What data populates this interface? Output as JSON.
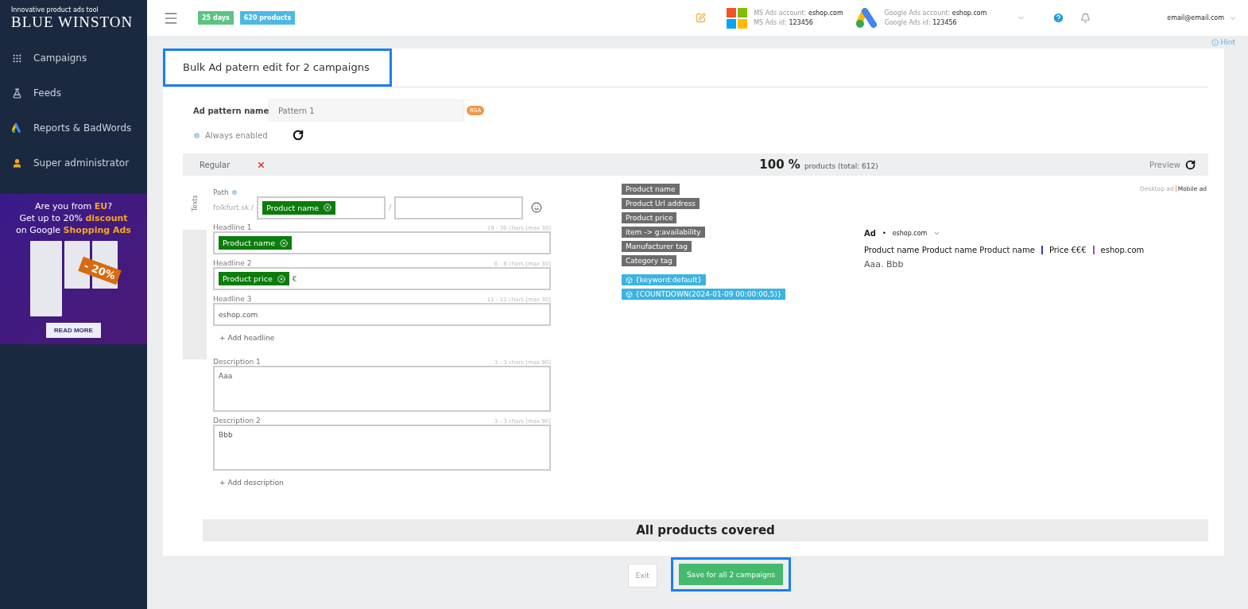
{
  "sidebar": {
    "tagline": "Innovative product ads tool",
    "logo": "BLUE WINSTON",
    "items": [
      {
        "label": "Campaigns",
        "kind": "grid",
        "selected": false
      },
      {
        "label": "Feeds",
        "kind": "flask",
        "selected": false
      },
      {
        "label": "Reports & BadWords",
        "kind": "ads",
        "selected": false
      },
      {
        "label": "Super administrator",
        "kind": "user",
        "selected": false
      }
    ],
    "banner": {
      "lines": [
        "Are you from **EU**?",
        "Get up to 20% **discount**",
        "on Google **Shopping Ads**"
      ],
      "tag": "- 20%",
      "button": "READ MORE"
    }
  },
  "topbar": {
    "badges": [
      {
        "text": "25 days",
        "color": "#5cc482"
      },
      {
        "text": "620 products",
        "color": "#4db8e6"
      }
    ],
    "accounts": [
      {
        "kind": "ms",
        "label": "MS Ads account:",
        "value": "eshop.com",
        "id_label": "MS Ads id:",
        "id": "123456"
      },
      {
        "kind": "google",
        "label": "Google Ads account:",
        "value": "eshop.com",
        "id_label": "Google Ads id:",
        "id": "123456"
      }
    ],
    "user": "email@email.com"
  },
  "hint": "Hint",
  "title": {
    "text": "Bulk Ad patern edit for 2 campaigns",
    "highlighted": true
  },
  "pattern": {
    "label": "Ad pattern name",
    "value": "Pattern 1",
    "badge": "RSA",
    "status": "Always enabled"
  },
  "tabs": [
    {
      "label": "Regular",
      "selected": true
    }
  ],
  "coverage": {
    "percent": "100 %",
    "text": "products (total: 612)",
    "preview": "Preview"
  },
  "side_tab": "Texts",
  "path": {
    "label": "Path",
    "domain": "folkfurt.sk /",
    "separator": "/",
    "tags": [
      "Product name"
    ]
  },
  "headlines": [
    {
      "label": "Headline 1",
      "counter": "19 - 30 chars [max 30]",
      "tags": [
        "Product name"
      ]
    },
    {
      "label": "Headline 2",
      "counter": "6 - 8 chars [max 30]",
      "tags": [
        "Product price"
      ],
      "text": "€"
    },
    {
      "label": "Headline 3",
      "counter": "11 - 11 chars [max 30]",
      "text": "eshop.com"
    }
  ],
  "add_headline": "+ Add headline",
  "descriptions": [
    {
      "label": "Description 1",
      "counter": "3 - 3 chars [max 90]",
      "text": "Aaa"
    },
    {
      "label": "Description 2",
      "counter": "3 - 3 chars [max 90]",
      "text": "Bbb"
    }
  ],
  "add_description": "+ Add description",
  "variables": [
    {
      "label": "Product name",
      "kind": "field"
    },
    {
      "label": "Product Url address",
      "kind": "field"
    },
    {
      "label": "Product price",
      "kind": "field"
    },
    {
      "label": "item -> g:availability",
      "kind": "field"
    },
    {
      "label": "Manufacturer tag",
      "kind": "field"
    },
    {
      "label": "Category tag",
      "kind": "field"
    },
    {
      "label": "{keyword:default}",
      "kind": "function"
    },
    {
      "label": "{COUNTDOWN(2024-01-09 00:00:00,5)}",
      "kind": "function"
    }
  ],
  "preview": {
    "views": [
      {
        "label": "Desktop ad",
        "selected": false
      },
      {
        "label": "Mobile ad",
        "selected": true
      }
    ],
    "ad_label": "Ad",
    "dot": "•",
    "domain": "eshop.com",
    "headlines": [
      "Product name Product name Product name",
      "Price €€€",
      "eshop.com"
    ],
    "description": "Aaa. Bbb"
  },
  "status": "All products covered",
  "buttons": [
    {
      "label": "Exit",
      "kind": "secondary",
      "highlighted": false
    },
    {
      "label": "Save for all 2 campaigns",
      "kind": "primary",
      "highlighted": true
    }
  ]
}
